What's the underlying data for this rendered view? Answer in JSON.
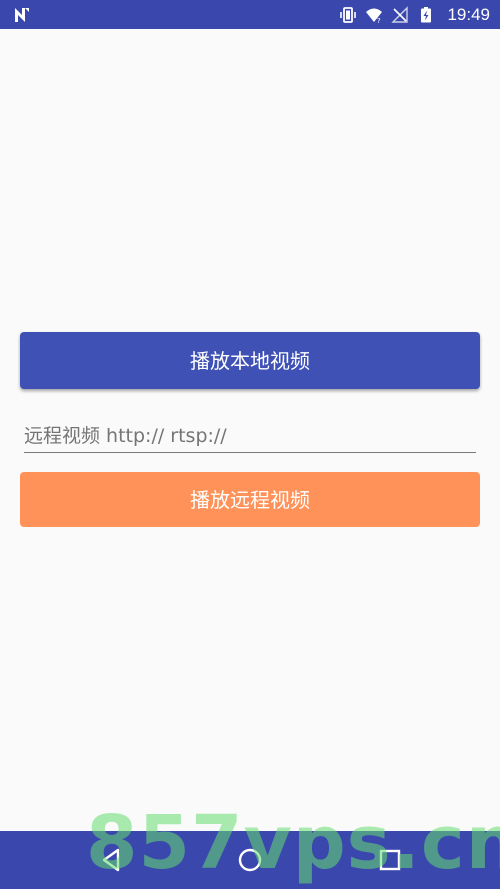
{
  "status_bar": {
    "time": "19:49",
    "icons": [
      "notification-n-icon",
      "vibrate-icon",
      "wifi-icon",
      "no-signal-icon",
      "battery-charging-icon"
    ]
  },
  "main": {
    "play_local_label": "播放本地视频",
    "url_input": {
      "value": "",
      "placeholder": "远程视频 http:// rtsp://"
    },
    "play_remote_label": "播放远程视频"
  },
  "nav_bar": {
    "icons": [
      "back-icon",
      "home-icon",
      "recents-icon"
    ]
  },
  "watermark": {
    "text": "857vps.cn"
  },
  "colors": {
    "status_bar": "#3a47ad",
    "primary_button": "#3f51b5",
    "accent_button": "#ff9259",
    "background": "#fafafa"
  }
}
